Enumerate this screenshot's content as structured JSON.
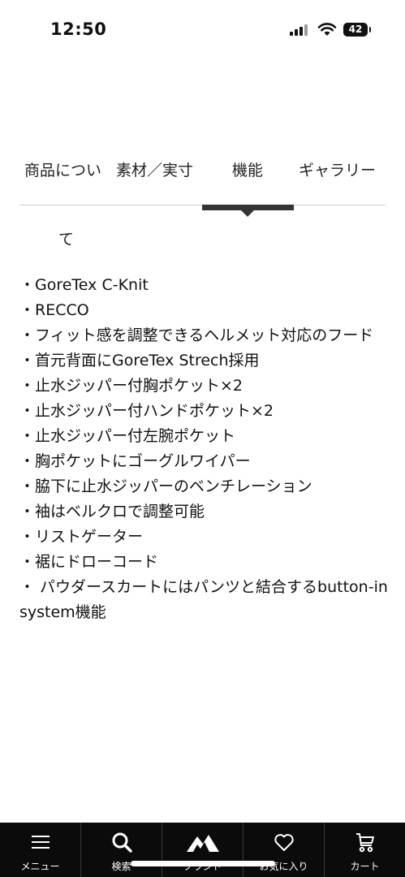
{
  "status_bar": {
    "time": "12:50",
    "battery": "42"
  },
  "tabs": {
    "items": [
      {
        "label": "商品につい"
      },
      {
        "label": "素材／実寸"
      },
      {
        "label": "機能"
      },
      {
        "label": "ギャラリー"
      }
    ],
    "wrap_text": "て",
    "active": "機能"
  },
  "features": [
    "・GoreTex C-Knit",
    "・RECCO",
    "・フィット感を調整できるヘルメット対応のフード",
    "・首元背面にGoreTex Strech採用",
    "・止水ジッパー付胸ポケット×2",
    "・止水ジッパー付ハンドポケット×2",
    "・止水ジッパー付左腕ポケット",
    "・胸ポケットにゴーグルワイパー",
    "・脇下に止水ジッパーのベンチレーション",
    "・袖はベルクロで調整可能",
    "・リストゲーター",
    "・裾にドローコード",
    "・ パウダースカートにはパンツと結合するbutton-in system機能"
  ],
  "bottom_nav": {
    "items": [
      {
        "label": "メニュー",
        "icon": "menu-icon"
      },
      {
        "label": "検索",
        "icon": "search-icon"
      },
      {
        "label": "ブランド",
        "icon": "mountain-logo-icon"
      },
      {
        "label": "お気に入り",
        "icon": "heart-icon"
      },
      {
        "label": "カート",
        "icon": "cart-icon"
      }
    ]
  }
}
